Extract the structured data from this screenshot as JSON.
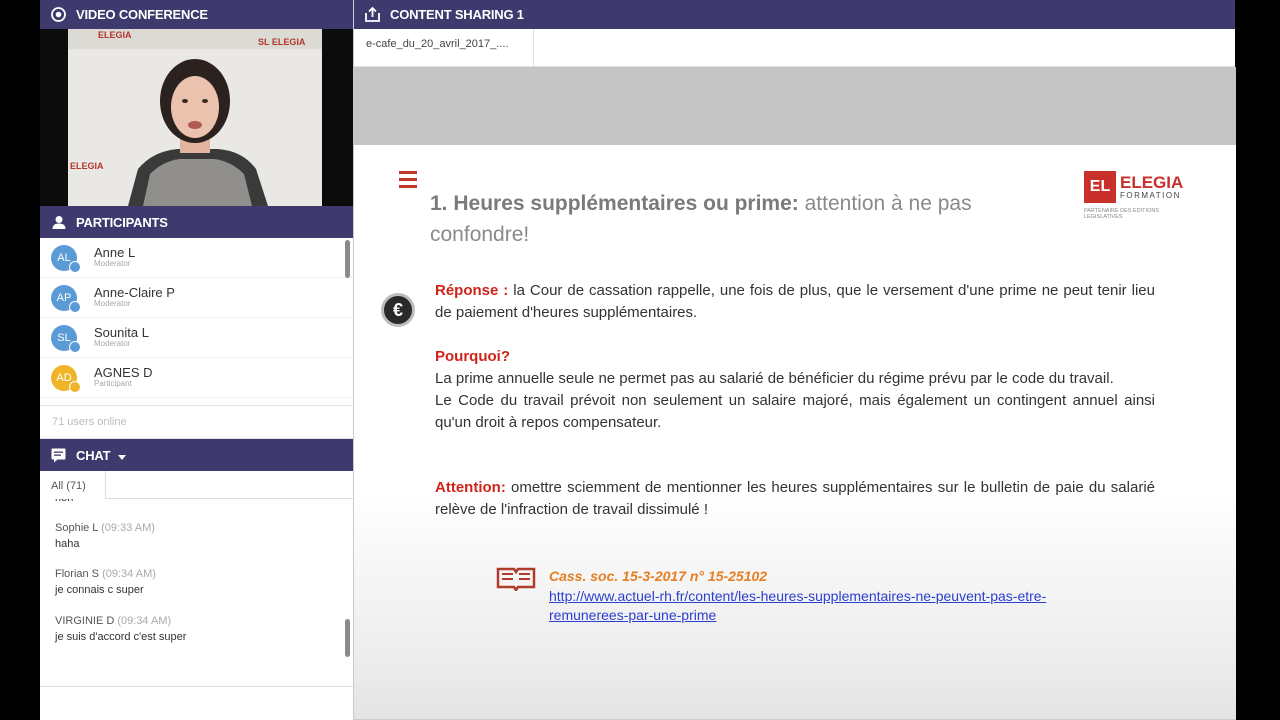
{
  "video": {
    "title": "VIDEO CONFERENCE",
    "logo_text_1": "ELEGIA",
    "logo_text_2": "SL ELEGIA",
    "logo_text_3": "ELEGIA"
  },
  "participants": {
    "title": "PARTICIPANTS",
    "online": "71 users online",
    "items": [
      {
        "initials": "AL",
        "name": "Anne L",
        "role": "Moderator",
        "color": "#5b9bd5",
        "badge": "#5b9bd5"
      },
      {
        "initials": "AP",
        "name": "Anne-Claire P",
        "role": "Moderator",
        "color": "#5b9bd5",
        "badge": "#5b9bd5"
      },
      {
        "initials": "SL",
        "name": "Sounita L",
        "role": "Moderator",
        "color": "#5b9bd5",
        "badge": "#5b9bd5"
      },
      {
        "initials": "AD",
        "name": "AGNES D",
        "role": "Participant",
        "color": "#f0b429",
        "badge": "#f0b429"
      }
    ]
  },
  "chat": {
    "title": "CHAT",
    "tab_all": "All (71)",
    "messages": [
      {
        "who": "",
        "time": "",
        "text": "non"
      },
      {
        "who": "Sophie L",
        "time": "(09:33 AM)",
        "text": "haha"
      },
      {
        "who": "Florian S",
        "time": "(09:34 AM)",
        "text": "je connais c super"
      },
      {
        "who": "VIRGINIE D",
        "time": "(09:34 AM)",
        "text": "je suis d'accord c'est super"
      }
    ]
  },
  "content": {
    "title": "CONTENT SHARING 1",
    "doc_tab": "e-cafe_du_20_avril_2017_...."
  },
  "slide": {
    "logo_main": "ELEGIA",
    "logo_sub": "FORMATION",
    "logo_tagline": "PARTENAIRE DES EDITIONS LEGISLATIVES",
    "title_bold": "1. Heures supplémentaires ou prime:",
    "title_rest": " attention à ne pas confondre!",
    "euro": "€",
    "reponse_label": "Réponse :",
    "reponse_text": " la Cour de cassation rappelle, une fois de plus, que le versement d'une prime ne peut tenir lieu de paiement d'heures supplémentaires.",
    "pourquoi_label": "Pourquoi?",
    "pourquoi_text1": "La prime annuelle seule ne permet pas au salarié de bénéficier du régime prévu par le code du travail.",
    "pourquoi_text2": "Le Code du travail  prévoit non seulement un salaire majoré, mais également un contingent annuel ainsi qu'un droit à repos compensateur.",
    "attention_label": "Attention:",
    "attention_text": " omettre sciemment de mentionner les heures supplémentaires sur le bulletin de paie du salarié relève de l'infraction de travail dissimulé !",
    "citation": "Cass. soc. 15-3-2017 n° 15-25102",
    "link_line1": "http://www.actuel-rh.fr/content/les-heures-supplementaires-ne-peuvent-pas-etre-",
    "link_line2": "remunerees-par-une-prime"
  }
}
